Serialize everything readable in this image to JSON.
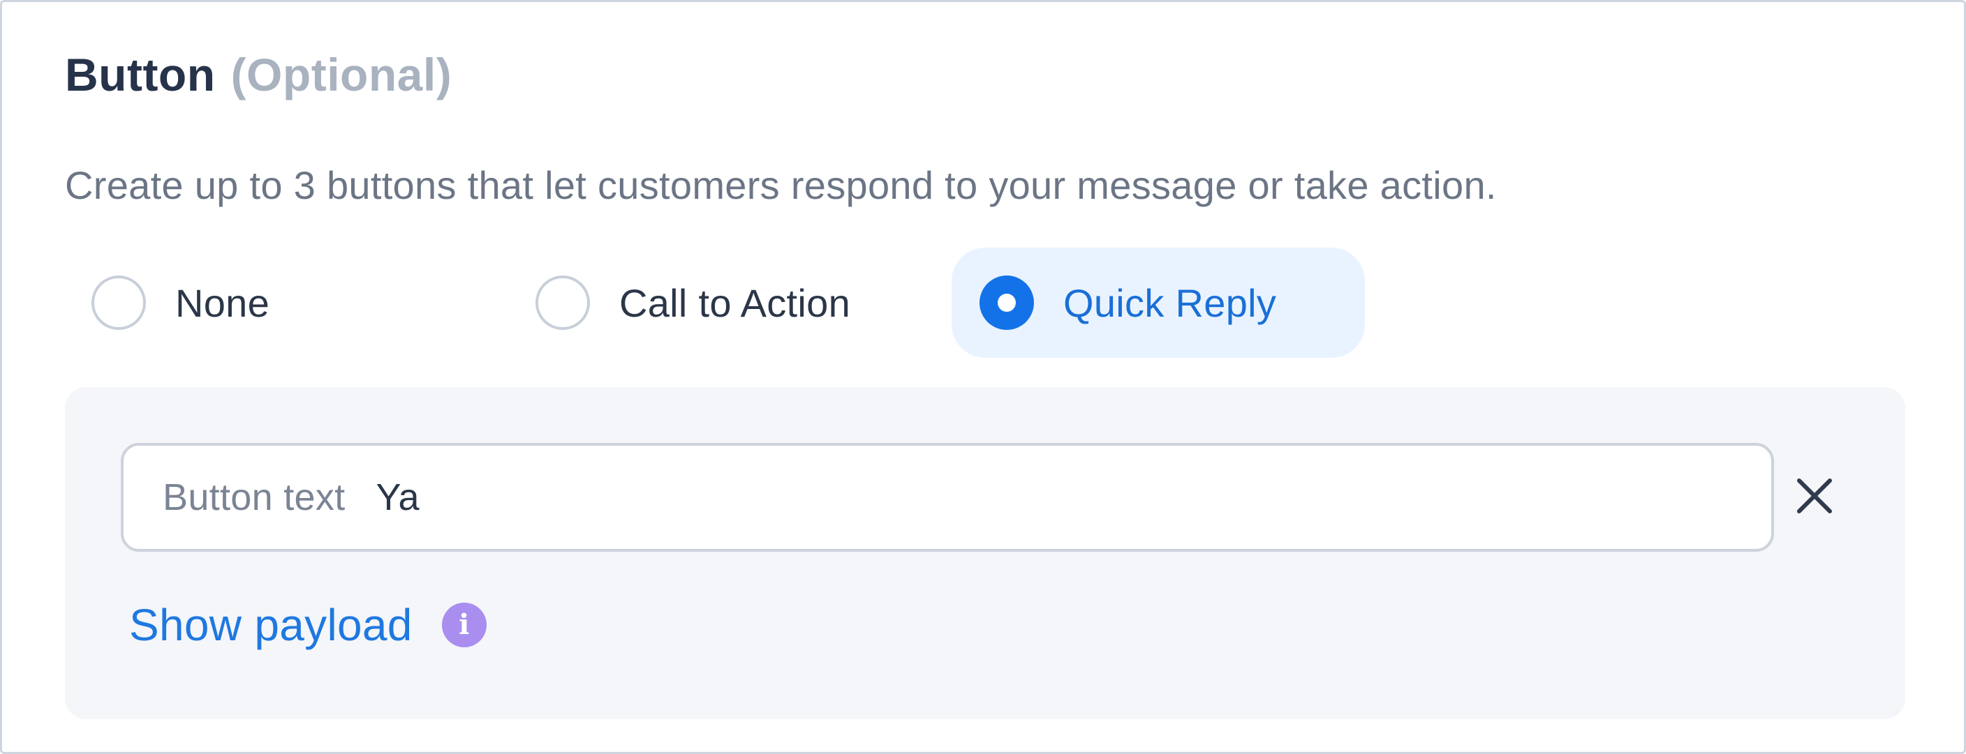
{
  "section": {
    "title": "Button",
    "optional_label": "(Optional)",
    "description": "Create up to 3 buttons that let customers respond to your message or take action."
  },
  "button_type": {
    "selected": "Quick Reply",
    "options": [
      {
        "label": "None",
        "selected": false
      },
      {
        "label": "Call to Action",
        "selected": false
      },
      {
        "label": "Quick Reply",
        "selected": true
      }
    ]
  },
  "quick_reply": {
    "input_prefix": "Button text",
    "input_value": "Ya",
    "remove_icon": "close-icon",
    "show_payload_label": "Show payload",
    "info_icon": "info-icon",
    "info_glyph": "i"
  },
  "colors": {
    "accent": "#1372e8",
    "selected_bg": "#e9f3ff",
    "panel_bg": "#f4f6f9",
    "info_icon": "#a98ef0",
    "title": "#26334a",
    "muted": "#a9b2bf"
  }
}
